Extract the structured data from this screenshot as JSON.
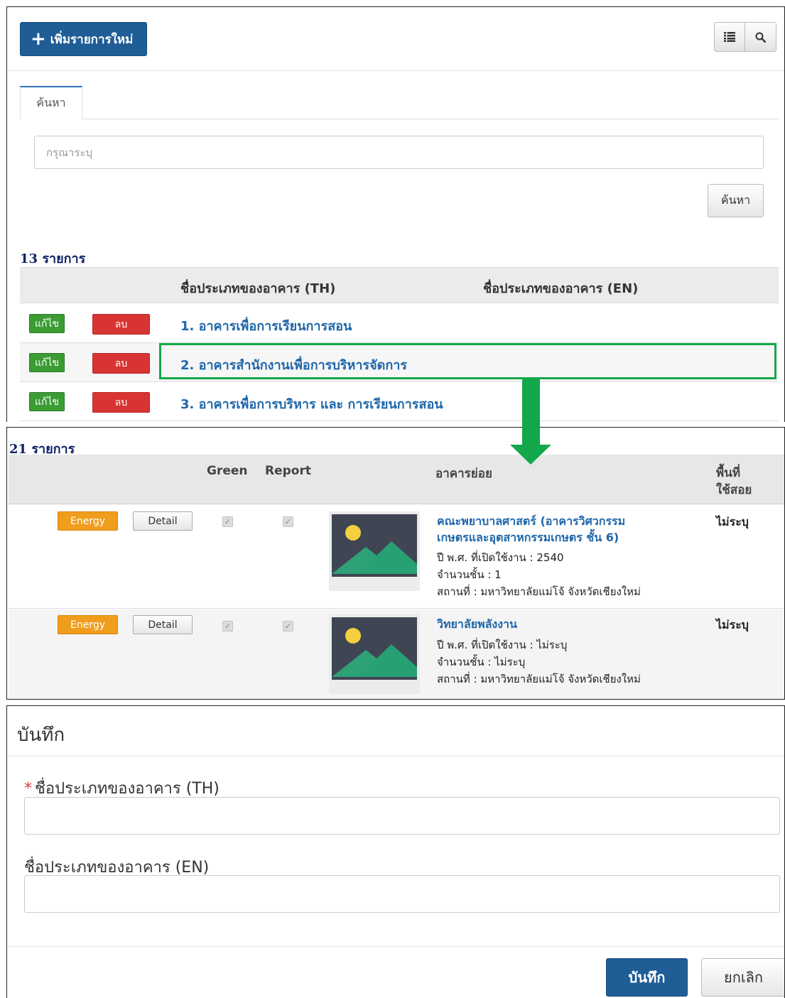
{
  "list_panel": {
    "add_button_label": "เพิ่มรายการใหม่",
    "view_buttons": [
      "list-icon",
      "search-icon"
    ],
    "search_tab_label": "ค้นหา",
    "search_placeholder": "กรุณาระบุ",
    "search_button_label": "ค้นหา",
    "record_count": "13 รายการ",
    "columns": [
      "ชื่อประเภทของอาคาร (TH)",
      "ชื่อประเภทของอาคาร (EN)"
    ],
    "rows": [
      {
        "edit": "แก้ไข",
        "delete": "ลบ",
        "name_th": "1. อาคารเพื่อการเรียนการสอน",
        "name_en": ""
      },
      {
        "edit": "แก้ไข",
        "delete": "ลบ",
        "name_th": "2. อาคารสำนักงานเพื่อการบริหารจัดการ",
        "name_en": ""
      },
      {
        "edit": "แก้ไข",
        "delete": "ลบ",
        "name_th": "3. อาคารเพื่อการบริหาร และ การเรียนการสอน",
        "name_en": ""
      }
    ],
    "highlight_color": "#14a84a"
  },
  "building_panel": {
    "record_count": "21 รายการ",
    "columns": {
      "green": "Green",
      "report": "Report",
      "sub_building": "อาคารย่อย",
      "area_line1": "พื้นที่",
      "area_line2": "ใช้สอย"
    },
    "rows": [
      {
        "energy": "Energy",
        "detail": "Detail",
        "green_checked": true,
        "report_checked": true,
        "name_line1": "คณะพยาบาลศาสตร์ (อาคารวิศวกรรม",
        "name_line2": "เกษตรและอุตสาหกรรมเกษตร ชั้น 6)",
        "year": "ปี พ.ศ. ที่เปิดใช้งาน : 2540",
        "floors": "จำนวนชั้น : 1",
        "location": "สถานที่ : มหาวิทยาลัยแม่โจ้ จังหวัดเชียงใหม่",
        "area": "ไม่ระบุ"
      },
      {
        "energy": "Energy",
        "detail": "Detail",
        "green_checked": true,
        "report_checked": true,
        "name_line1": "วิทยาลัยพลังงาน",
        "name_line2": "",
        "year": "ปี พ.ศ. ที่เปิดใช้งาน : ไม่ระบุ",
        "floors": "จำนวนชั้น : ไม่ระบุ",
        "location": "สถานที่ : มหาวิทยาลัยแม่โจ้ จังหวัดเชียงใหม่",
        "area": "ไม่ระบุ"
      }
    ]
  },
  "form_panel": {
    "title": "บันทึก",
    "required_mark": "*",
    "field_th_label": "ชื่อประเภทของอาคาร (TH)",
    "field_th_value": "",
    "field_en_label": "ชื่อประเภทของอาคาร (EN)",
    "field_en_value": "",
    "save_label": "บันทึก",
    "cancel_label": "ยกเลิก"
  },
  "colors": {
    "primary": "#1f5d96",
    "edit_green": "#3a9c33",
    "delete_red": "#d83434",
    "energy_orange": "#f09d1e",
    "arrow_green": "#12a84b",
    "link_blue": "#1f67aa"
  }
}
